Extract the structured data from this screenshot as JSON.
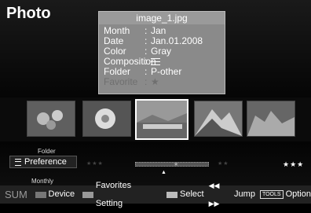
{
  "page_title": "Photo",
  "info": {
    "filename": "image_1.jpg",
    "fields": [
      {
        "key": "Month",
        "value": "Jan"
      },
      {
        "key": "Date",
        "value": "Jan.01.2008"
      },
      {
        "key": "Color",
        "value": "Gray"
      },
      {
        "key": "Composition",
        "value": ""
      },
      {
        "key": "Folder",
        "value": "P-other"
      },
      {
        "key": "Favorite",
        "value": "★"
      }
    ]
  },
  "thumbnails": [
    {
      "name": "thumb-flowers",
      "selected": false
    },
    {
      "name": "thumb-flower",
      "selected": false
    },
    {
      "name": "thumb-landscape",
      "selected": true
    },
    {
      "name": "thumb-mountain",
      "selected": false
    },
    {
      "name": "thumb-rocks",
      "selected": false
    }
  ],
  "sort": {
    "above": "Folder",
    "current": "Preference",
    "below": "Monthly"
  },
  "rating_segments": [
    "★★★",
    "★★",
    "★",
    "★★",
    "★★★"
  ],
  "statusbar": {
    "sum": "SUM",
    "device": "Device",
    "favorites": "Favorites Setting",
    "select": "Select",
    "jump_arrows": "◀◀ ▶▶",
    "jump": "Jump",
    "tools_label": "TOOLS",
    "option": "Option"
  }
}
